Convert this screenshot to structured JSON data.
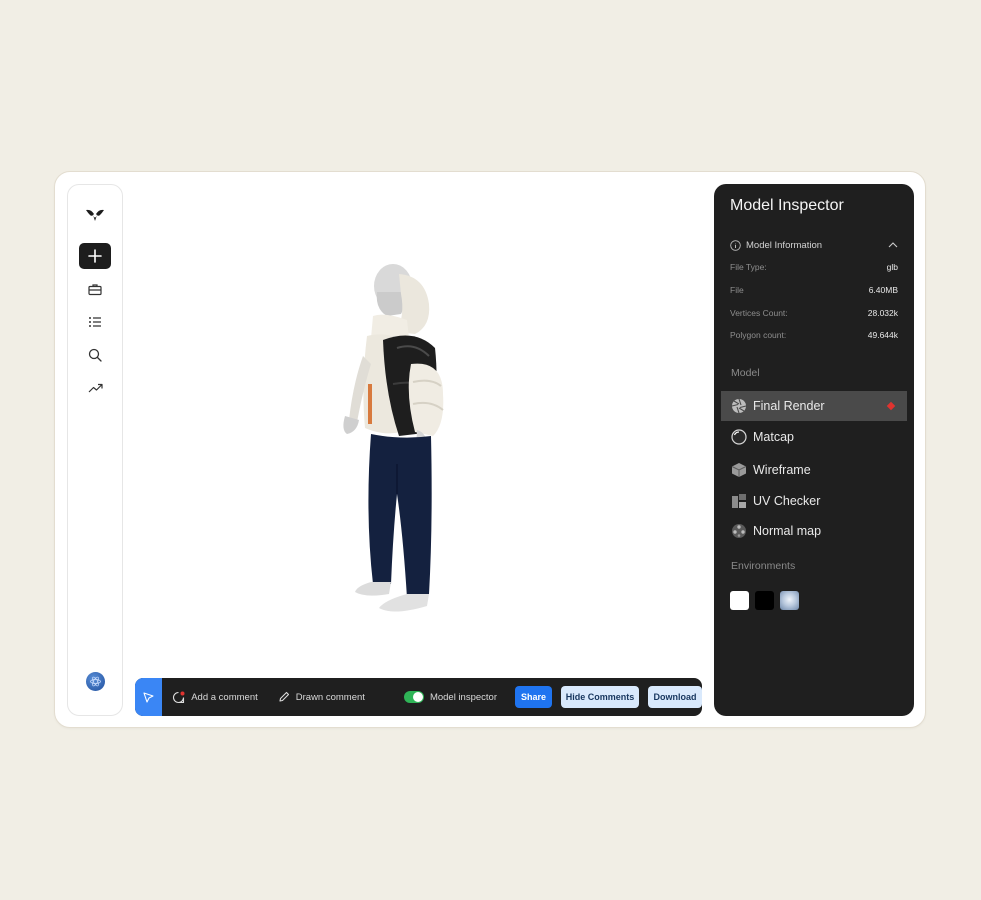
{
  "toolbar": {
    "add_comment": "Add a comment",
    "drawn_comment": "Drawn comment",
    "model_inspector": "Model inspector",
    "model_inspector_on": true,
    "share": "Share",
    "hide_comments": "Hide Comments",
    "download": "Download"
  },
  "inspector": {
    "title": "Model Inspector",
    "info_header": "Model Information",
    "info": [
      {
        "key": "File Type:",
        "value": "glb"
      },
      {
        "key": "File",
        "value": "6.40MB"
      },
      {
        "key": "Vertices Count:",
        "value": "28.032k"
      },
      {
        "key": "Polygon count:",
        "value": "49.644k"
      }
    ],
    "model_label": "Model",
    "model_options": [
      {
        "label": "Final Render",
        "icon": "aperture-icon",
        "selected": true
      },
      {
        "label": "Matcap",
        "icon": "sphere-icon",
        "selected": false
      },
      {
        "label": "Wireframe",
        "icon": "cube-icon",
        "selected": false
      },
      {
        "label": "UV Checker",
        "icon": "uv-checker-icon",
        "selected": false
      },
      {
        "label": "Normal map",
        "icon": "normal-map-icon",
        "selected": false
      }
    ],
    "environments_label": "Environments",
    "environments": [
      {
        "name": "white",
        "color": "#ffffff"
      },
      {
        "name": "black",
        "color": "#000000"
      },
      {
        "name": "sky",
        "color": "#9fb7d6"
      }
    ]
  },
  "sidebar": {
    "items": [
      "logo-icon",
      "plus-icon",
      "briefcase-icon",
      "list-icon",
      "search-icon",
      "trending-icon"
    ]
  },
  "colors": {
    "accent": "#1f74f0",
    "toggle_on": "#2fb457",
    "selected_marker": "#e0332f"
  }
}
